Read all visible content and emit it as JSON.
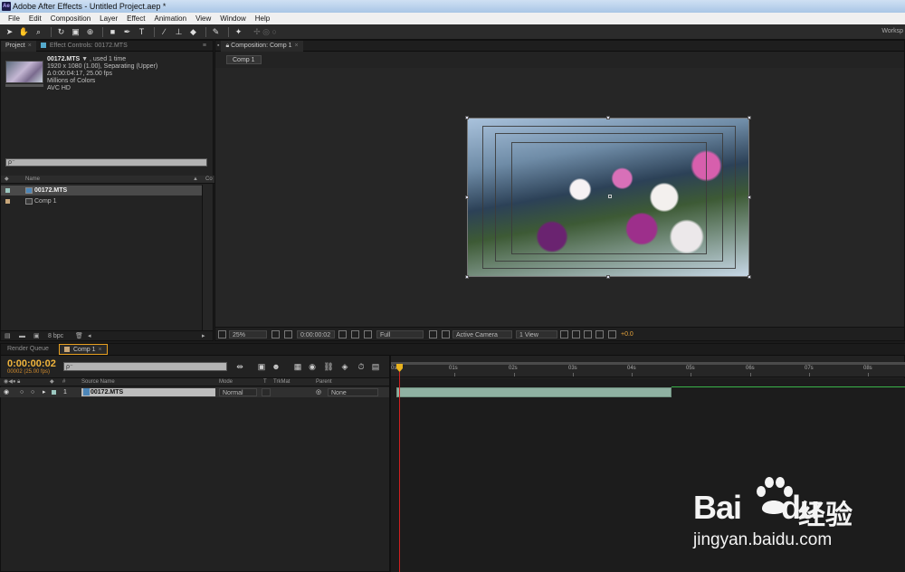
{
  "window": {
    "title": "Adobe After Effects - Untitled Project.aep *",
    "logo": "Ae"
  },
  "menu": [
    "File",
    "Edit",
    "Composition",
    "Layer",
    "Effect",
    "Animation",
    "View",
    "Window",
    "Help"
  ],
  "toolbar": {
    "workspace_label": "Worksp"
  },
  "project_panel": {
    "tab_project": "Project",
    "tab_effect_controls": "Effect Controls: 00172.MTS",
    "file_name": "00172.MTS",
    "file_usage": "▼ , used 1 time",
    "info_lines": [
      "1920 x 1080 (1.00), Separating (Upper)",
      "Δ 0:00:04:17, 25.00 fps",
      "Millions of Colors",
      "AVC HD"
    ],
    "search_icon": "ρ⁻",
    "col_name": "Name",
    "col_comment": "Co",
    "items": [
      {
        "name": "00172.MTS",
        "label_color": "#9cc8c0"
      },
      {
        "name": "Comp 1",
        "label_color": "#c8a77a"
      }
    ],
    "bpc": "8 bpc"
  },
  "comp_panel": {
    "tab_label": "Composition: Comp 1",
    "flow_tab": "Comp 1",
    "zoom": "25%",
    "timecode": "0:00:00:02",
    "resolution": "Full",
    "camera": "Active Camera",
    "views": "1 View",
    "exposure": "+0.0"
  },
  "timeline": {
    "tab_render_queue": "Render Queue",
    "tab_comp": "Comp 1",
    "current_time": "0:00:00:02",
    "frames_fps": "00002 (25.00 fps)",
    "search_icon": "ρ⁻",
    "columns": {
      "num": "#",
      "source_name": "Source Name",
      "mode": "Mode",
      "t": "T",
      "trkmat": "TrkMat",
      "parent": "Parent"
    },
    "layers": [
      {
        "index": "1",
        "name": "00172.MTS",
        "mode": "Normal",
        "trkmat": "",
        "parent": "None"
      }
    ],
    "ruler_labels": [
      "0s",
      "01s",
      "02s",
      "03s",
      "04s",
      "05s",
      "06s",
      "07s",
      "08s"
    ]
  },
  "watermark": {
    "brand": "Bai",
    "brand_tail": "du",
    "cn": "经验",
    "url": "jingyan.baidu.com"
  }
}
